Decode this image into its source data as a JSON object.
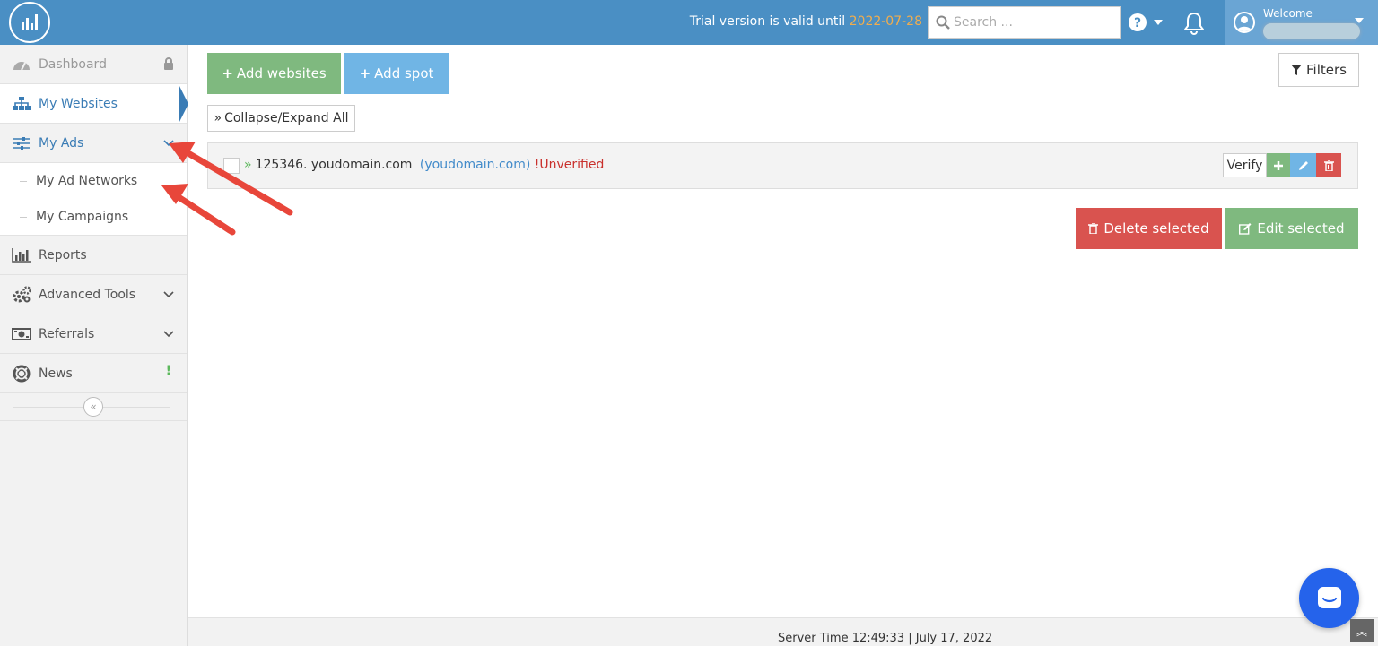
{
  "colors": {
    "header_bg": "#4a8fc4",
    "accent_blue": "#3a7cb5",
    "trial_date": "#f0ad4e",
    "btn_green": "#7fb97f",
    "btn_blue": "#70b5e5",
    "btn_red": "#d9534f",
    "annotation_arrow": "#e8463a"
  },
  "header": {
    "trial_text": "Trial version is valid until",
    "trial_date": "2022-07-28",
    "search_placeholder": "Search ...",
    "help_icon": "question-circle-icon",
    "bell_icon": "bell-icon",
    "welcome": "Welcome"
  },
  "sidebar": {
    "items": [
      {
        "label": "Dashboard",
        "icon": "dashboard-icon",
        "badge_icon": "lock-icon"
      },
      {
        "label": "My Websites",
        "icon": "sitemap-icon"
      },
      {
        "label": "My Ads",
        "icon": "sliders-icon",
        "expanded": true,
        "children": [
          {
            "label": "My Ad Networks"
          },
          {
            "label": "My Campaigns"
          }
        ]
      },
      {
        "label": "Reports",
        "icon": "bar-chart-icon"
      },
      {
        "label": "Advanced Tools",
        "icon": "cogs-icon"
      },
      {
        "label": "Referrals",
        "icon": "money-icon"
      },
      {
        "label": "News",
        "icon": "life-ring-icon",
        "badge": "!"
      }
    ],
    "collapse_glyph": "«"
  },
  "toolbar": {
    "add_websites": "Add websites",
    "add_spot": "Add spot",
    "filters": "Filters",
    "collapse_expand": "Collapse/Expand All"
  },
  "sites": [
    {
      "id_name": "125346. youdomain.com",
      "link": "(youdomain.com)",
      "status": "!Unverified",
      "verify_label": "Verify"
    }
  ],
  "actions": {
    "delete_selected": "Delete selected",
    "edit_selected": "Edit selected"
  },
  "footer": {
    "server_time": "Server Time 12:49:33 | July 17, 2022"
  }
}
